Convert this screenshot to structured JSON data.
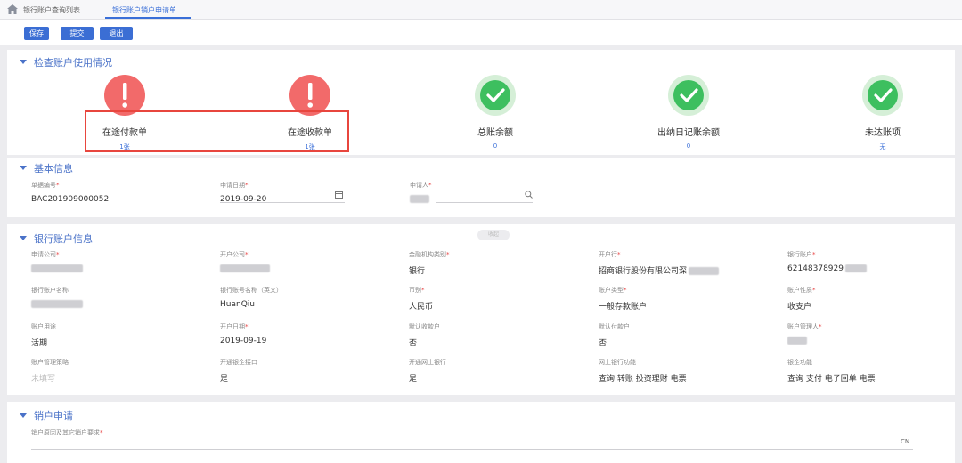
{
  "tabs": [
    {
      "label": "银行账户查询列表"
    },
    {
      "label": "银行账户销户申请单"
    }
  ],
  "toolbar": {
    "save": "保存",
    "submit": "提交",
    "exit": "退出"
  },
  "check_section": {
    "title": "检查账户使用情况",
    "items": [
      {
        "label": "在途付款单",
        "value": "1张",
        "status": "warning"
      },
      {
        "label": "在途收款单",
        "value": "1张",
        "status": "warning"
      },
      {
        "label": "总账余额",
        "value": "0",
        "status": "ok"
      },
      {
        "label": "出纳日记账余额",
        "value": "0",
        "status": "ok"
      },
      {
        "label": "未达账项",
        "value": "无",
        "status": "ok"
      }
    ]
  },
  "basic": {
    "title": "基本信息",
    "doc_no_label": "单据编号",
    "doc_no": "BAC201909000052",
    "date_label": "申请日期",
    "date": "2019-09-20",
    "applicant_label": "申请人"
  },
  "bank": {
    "title": "银行账户信息",
    "pill": "收起",
    "f1_label": "申请公司",
    "f2_label": "开户公司",
    "f3_label": "金融机构类别",
    "f3_value": "银行",
    "f4_label": "开户行",
    "f4_value": "招商银行股份有限公司深",
    "f5_label": "银行账户",
    "f5_value": "62148378929",
    "f6_label": "银行账户名称",
    "f7_label": "银行账号名称（英文）",
    "f7_value": "HuanQiu",
    "f8_label": "币别",
    "f8_value": "人民币",
    "f9_label": "账户类型",
    "f9_value": "一般存款账户",
    "f10_label": "账户性质",
    "f10_value": "收支户",
    "f11_label": "账户用途",
    "f11_value": "活期",
    "f12_label": "开户日期",
    "f12_value": "2019-09-19",
    "f13_label": "默认收款户",
    "f13_value": "否",
    "f14_label": "默认付款户",
    "f14_value": "否",
    "f15_label": "账户管理人",
    "f16_label": "账户管理策略",
    "f16_value": "未填写",
    "f17_label": "开通银企接口",
    "f17_value": "是",
    "f18_label": "开通网上银行",
    "f18_value": "是",
    "f19_label": "网上银行功能",
    "f19_value": "查询 转账 投资理财 电票",
    "f20_label": "银企功能",
    "f20_value": "查询 支付 电子回单 电票"
  },
  "close": {
    "title": "销户申请",
    "reason_label": "销户原因及其它销户要求",
    "lang": "CN"
  },
  "colors": {
    "primary": "#3b6ed4",
    "warning": "#f26a6a",
    "ok": "#3dbf5f",
    "highlight": "#e8463e"
  }
}
